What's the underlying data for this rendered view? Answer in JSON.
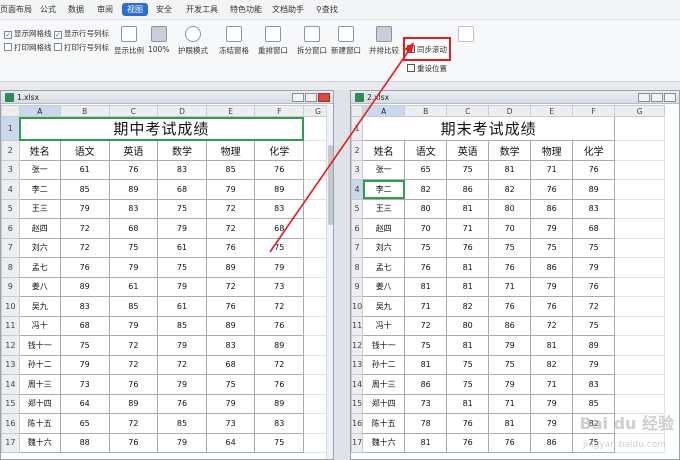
{
  "menubar": {
    "items": [
      "页面布局",
      "公式",
      "数据",
      "审阅",
      "视图",
      "安全",
      "开发工具",
      "特色功能",
      "文档助手",
      "查找"
    ],
    "active": "视图"
  },
  "ribbon": {
    "show_gridlines": "显示网格线",
    "show_row_col_headers": "显示行号列标",
    "print_gridlines": "打印网格线",
    "print_row_col_headers": "打印行号列标",
    "show_ratio": "显示比例",
    "zoom": "100%",
    "eye_mode": "护眼模式",
    "freeze_panes": "冻结窗格",
    "rearrange": "重排窗口",
    "split_window": "拆分窗口",
    "new_window": "新建窗口",
    "side_by_side": "并排比较",
    "sync_scroll": "同步滚动",
    "reset_position": "重设位置"
  },
  "colors": {
    "accent": "#2b6fd6",
    "highlight": "#e41d1d",
    "selection": "#2e9e4a"
  },
  "window1": {
    "filename": "1.xlsx",
    "columns": [
      "A",
      "B",
      "C",
      "D",
      "E",
      "F",
      "G"
    ],
    "title": "期中考试成绩",
    "headers": [
      "姓名",
      "语文",
      "英语",
      "数学",
      "物理",
      "化学"
    ],
    "rows": [
      [
        "张一",
        "61",
        "76",
        "83",
        "85",
        "76"
      ],
      [
        "李二",
        "85",
        "89",
        "68",
        "79",
        "89"
      ],
      [
        "王三",
        "79",
        "83",
        "75",
        "72",
        "83"
      ],
      [
        "赵四",
        "72",
        "68",
        "79",
        "72",
        "68"
      ],
      [
        "刘六",
        "72",
        "75",
        "61",
        "76",
        "75"
      ],
      [
        "孟七",
        "76",
        "79",
        "75",
        "89",
        "79"
      ],
      [
        "姜八",
        "89",
        "61",
        "79",
        "72",
        "73"
      ],
      [
        "吴九",
        "83",
        "85",
        "61",
        "76",
        "72"
      ],
      [
        "冯十",
        "68",
        "79",
        "85",
        "89",
        "76"
      ],
      [
        "钱十一",
        "75",
        "72",
        "79",
        "83",
        "89"
      ],
      [
        "孙十二",
        "79",
        "72",
        "72",
        "68",
        "72"
      ],
      [
        "周十三",
        "73",
        "76",
        "79",
        "75",
        "76"
      ],
      [
        "郑十四",
        "64",
        "89",
        "76",
        "79",
        "89"
      ],
      [
        "陈十五",
        "65",
        "72",
        "85",
        "73",
        "83"
      ],
      [
        "魏十六",
        "88",
        "76",
        "79",
        "64",
        "75"
      ]
    ]
  },
  "window2": {
    "filename": "2.xlsx",
    "columns": [
      "A",
      "B",
      "C",
      "D",
      "E",
      "F",
      "G"
    ],
    "title": "期末考试成绩",
    "headers": [
      "姓名",
      "语文",
      "英语",
      "数学",
      "物理",
      "化学"
    ],
    "rows": [
      [
        "张一",
        "65",
        "75",
        "81",
        "71",
        "76"
      ],
      [
        "李二",
        "82",
        "86",
        "82",
        "76",
        "89"
      ],
      [
        "王三",
        "80",
        "81",
        "80",
        "86",
        "83"
      ],
      [
        "赵四",
        "70",
        "71",
        "70",
        "79",
        "68"
      ],
      [
        "刘六",
        "75",
        "76",
        "75",
        "75",
        "75"
      ],
      [
        "孟七",
        "76",
        "81",
        "76",
        "86",
        "79"
      ],
      [
        "姜八",
        "81",
        "81",
        "71",
        "79",
        "76"
      ],
      [
        "吴九",
        "71",
        "82",
        "76",
        "76",
        "72"
      ],
      [
        "冯十",
        "72",
        "80",
        "86",
        "72",
        "75"
      ],
      [
        "钱十一",
        "75",
        "81",
        "79",
        "81",
        "89"
      ],
      [
        "孙十二",
        "81",
        "75",
        "75",
        "82",
        "79"
      ],
      [
        "周十三",
        "86",
        "75",
        "79",
        "71",
        "83"
      ],
      [
        "郑十四",
        "73",
        "81",
        "71",
        "79",
        "85"
      ],
      [
        "陈十五",
        "78",
        "76",
        "81",
        "79",
        "82"
      ],
      [
        "魏十六",
        "81",
        "76",
        "76",
        "86",
        "75"
      ]
    ]
  },
  "watermark": {
    "main": "Bai du 经验",
    "sub": "jingyan.baidu.com"
  }
}
